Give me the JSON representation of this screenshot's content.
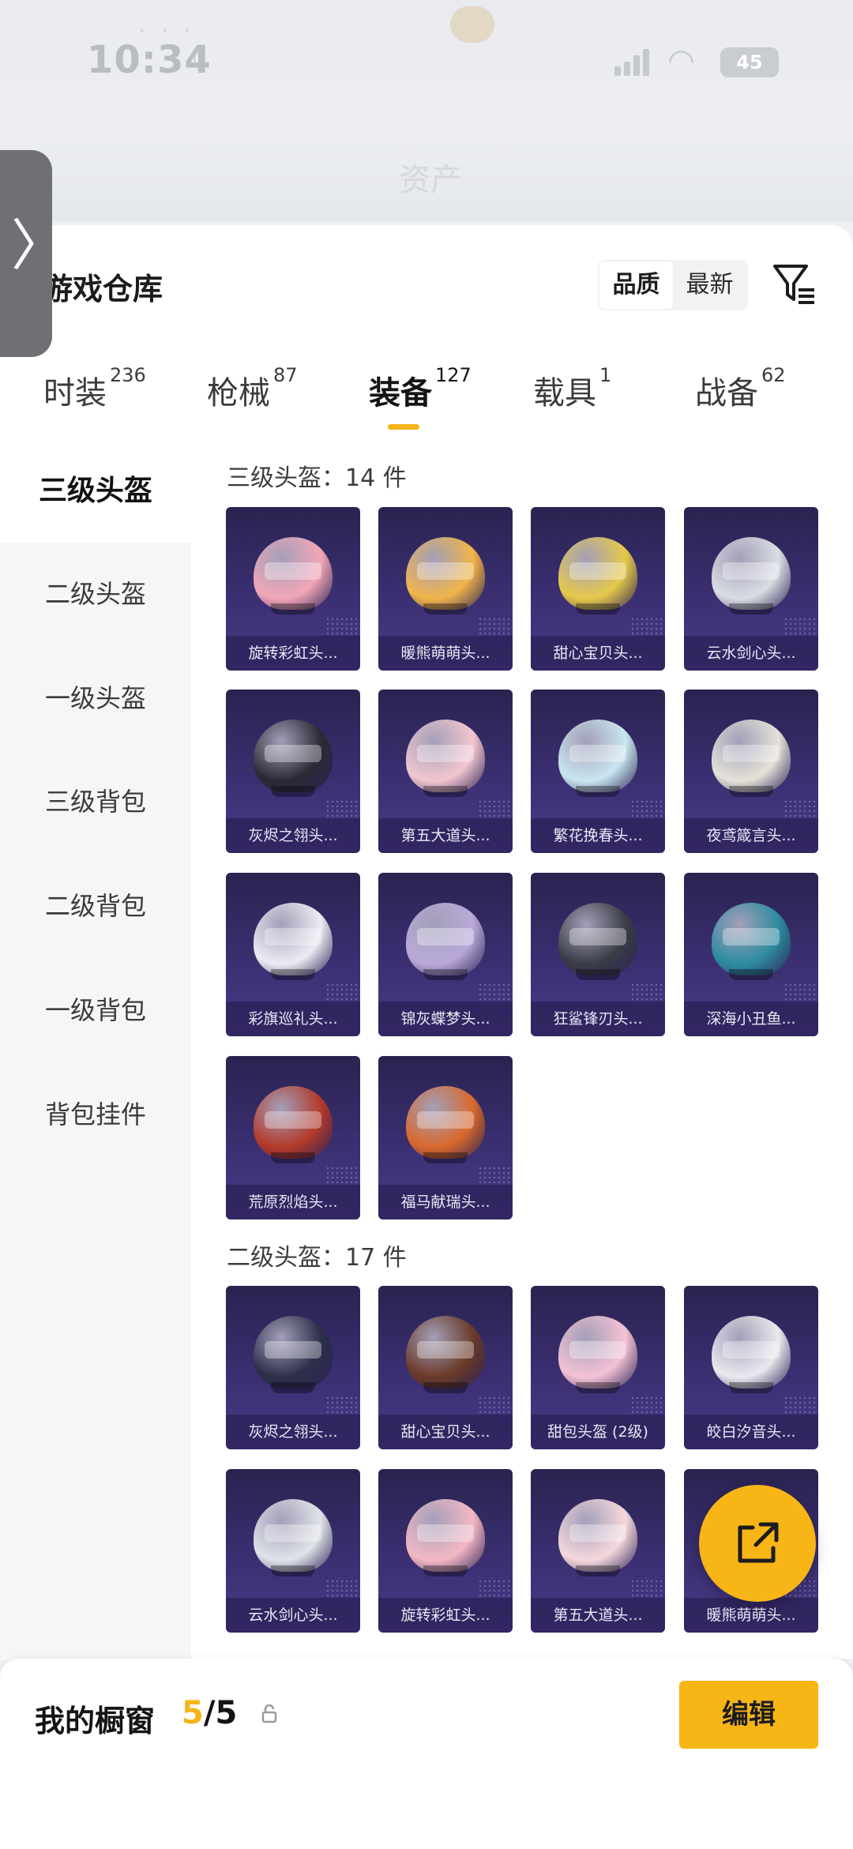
{
  "status_bar": {
    "time": "10:34",
    "battery": "45"
  },
  "page": {
    "header_tab": "资产",
    "title": "游戏仓库"
  },
  "sort": {
    "quality_label": "品质",
    "newest_label": "最新"
  },
  "tabs": [
    {
      "label": "时装",
      "count": "236",
      "active": false
    },
    {
      "label": "枪械",
      "count": "87",
      "active": false
    },
    {
      "label": "装备",
      "count": "127",
      "active": true
    },
    {
      "label": "载具",
      "count": "1",
      "active": false
    },
    {
      "label": "战备",
      "count": "62",
      "active": false
    }
  ],
  "categories": [
    "三级头盔",
    "二级头盔",
    "一级头盔",
    "三级背包",
    "二级背包",
    "一级背包",
    "背包挂件"
  ],
  "sections": [
    {
      "title": "三级头盔：14 件",
      "items": [
        {
          "name": "旋转彩虹头...",
          "color": "#f2a6b7"
        },
        {
          "name": "暖熊萌萌头...",
          "color": "#f0b44a"
        },
        {
          "name": "甜心宝贝头...",
          "color": "#e5c94a"
        },
        {
          "name": "云水剑心头...",
          "color": "#d9dde3"
        },
        {
          "name": "灰烬之翎头...",
          "color": "#2a2a36"
        },
        {
          "name": "第五大道头...",
          "color": "#f2c6cf"
        },
        {
          "name": "繁花挽春头...",
          "color": "#c9e6ef"
        },
        {
          "name": "夜鸢箴言头...",
          "color": "#e4e2d8"
        },
        {
          "name": "彩旗巡礼头...",
          "color": "#ecebf3"
        },
        {
          "name": "锦灰蝶梦头...",
          "color": "#b9a9d9"
        },
        {
          "name": "狂鲨锋刃头...",
          "color": "#3a3d46"
        },
        {
          "name": "深海小丑鱼...",
          "color": "#2d8ca0"
        },
        {
          "name": "荒原烈焰头...",
          "color": "#b33a2a"
        },
        {
          "name": "福马献瑞头...",
          "color": "#d8692c"
        }
      ]
    },
    {
      "title": "二级头盔：17 件",
      "items": [
        {
          "name": "灰烬之翎头...",
          "color": "#2c2f4a"
        },
        {
          "name": "甜心宝贝头...",
          "color": "#6a3a28"
        },
        {
          "name": "甜包头盔 (2级)",
          "color": "#f4c2d4"
        },
        {
          "name": "皎白汐音头...",
          "color": "#e9e9ee"
        },
        {
          "name": "云水剑心头...",
          "color": "#dfe3e8"
        },
        {
          "name": "旋转彩虹头...",
          "color": "#f4b8c4"
        },
        {
          "name": "第五大道头...",
          "color": "#f5d8dc"
        },
        {
          "name": "暖熊萌萌头...",
          "color": "#e8c27a"
        }
      ]
    }
  ],
  "showcase": {
    "title": "我的橱窗",
    "current": "5",
    "total": "/5",
    "edit_label": "编辑"
  }
}
